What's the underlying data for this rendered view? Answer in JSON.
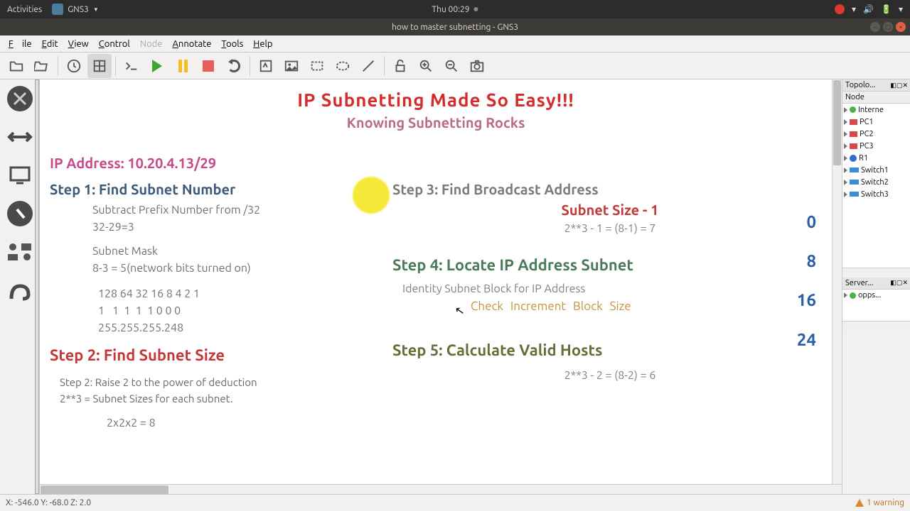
{
  "sysbar": {
    "activities": "Activities",
    "app": "GNS3",
    "clock": "Thu 00:29"
  },
  "titlebar": {
    "title": "how to master subnetting - GNS3"
  },
  "menu": {
    "file": "File",
    "edit": "Edit",
    "view": "View",
    "control": "Control",
    "node": "Node",
    "annotate": "Annotate",
    "tools": "Tools",
    "help": "Help"
  },
  "canvas": {
    "title": "IP Subnetting Made So Easy!!!",
    "subtitle": "Knowing Subnetting Rocks",
    "ip_line": "IP Address: 10.20.4.13/29",
    "step1_h": "Step 1: Find Subnet Number",
    "step1_l1": "Subtract Prefix Number from /32",
    "step1_l2": "32-29=3",
    "step1_l3": "Subnet Mask",
    "step1_l4": "8-3 = 5(network bits turned on)",
    "step1_bits1": "128 64 32 16 8 4 2 1",
    "step1_bits2": "1   1  1  1  1 0 0 0",
    "step1_bits3": "255.255.255.248",
    "step2_h": "Step 2: Find Subnet Size",
    "step2_l1": "Step 2: Raise 2 to the power of deduction",
    "step2_l2": "2**3 = Subnet Sizes for each subnet.",
    "step2_l3": "2x2x2 = 8",
    "step3_h": "Step 3: Find Broadcast Address",
    "step3_sub": "Subnet Size - 1",
    "step3_f": "2**3 - 1 = (8-1) = 7",
    "step4_h": "Step 4: Locate IP Address Subnet",
    "step4_l1": "Identity Subnet Block for IP Address",
    "step4_l2": "Check  Increment Block Size",
    "step5_h": "Step 5: Calculate Valid Hosts",
    "step5_f": "2**3 - 2 = (8-2) = 6",
    "nums": [
      "0",
      "8",
      "16",
      "24"
    ]
  },
  "panels": {
    "topo_title": "Topolo...",
    "node_title": "Node",
    "servers_title": "Server...",
    "nodes": [
      "Interne",
      "PC1",
      "PC2",
      "PC3",
      "R1",
      "Switch1",
      "Switch2",
      "Switch3"
    ],
    "server_item": "opps..."
  },
  "status": {
    "coords": "X: -546.0 Y: -68.0 Z: 2.0",
    "warn": "1 warning"
  }
}
